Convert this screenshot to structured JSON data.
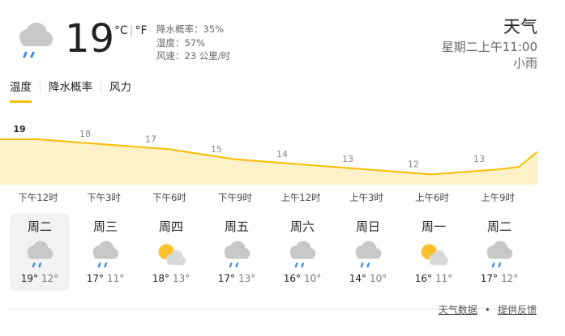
{
  "current": {
    "temp": "19",
    "unit_c": "°C",
    "unit_f": "°F",
    "precip": "降水概率：35%",
    "humidity": "湿度：57%",
    "wind": "风速：23 公里/时",
    "icon": "cloud-rain-icon"
  },
  "header": {
    "title": "天气",
    "datetime": "星期二上午11:00",
    "condition": "小雨"
  },
  "tabs": [
    {
      "label": "温度",
      "active": true
    },
    {
      "label": "降水概率",
      "active": false
    },
    {
      "label": "风力",
      "active": false
    }
  ],
  "chart_data": {
    "type": "area",
    "x": [
      "下午12时",
      "下午3时",
      "下午6时",
      "下午9时",
      "上午12时",
      "上午3时",
      "上午6时",
      "上午9时"
    ],
    "values": [
      19,
      18,
      17,
      15,
      14,
      13,
      12,
      13
    ],
    "color": "#fbbc04",
    "fill": "#fdf1c7"
  },
  "days": [
    {
      "name": "周二",
      "icon": "cloud-rain-icon",
      "hi": "19°",
      "lo": "12°",
      "selected": true
    },
    {
      "name": "周三",
      "icon": "cloud-rain-icon",
      "hi": "17°",
      "lo": "11°",
      "selected": false
    },
    {
      "name": "周四",
      "icon": "partly-sunny-icon",
      "hi": "18°",
      "lo": "13°",
      "selected": false
    },
    {
      "name": "周五",
      "icon": "cloud-rain-icon",
      "hi": "17°",
      "lo": "13°",
      "selected": false
    },
    {
      "name": "周六",
      "icon": "cloud-rain-icon",
      "hi": "16°",
      "lo": "10°",
      "selected": false
    },
    {
      "name": "周日",
      "icon": "cloud-rain-icon",
      "hi": "14°",
      "lo": "10°",
      "selected": false
    },
    {
      "name": "周一",
      "icon": "partly-sunny-icon",
      "hi": "16°",
      "lo": "11°",
      "selected": false
    },
    {
      "name": "周二",
      "icon": "cloud-rain-icon",
      "hi": "17°",
      "lo": "12°",
      "selected": false
    }
  ],
  "footer": {
    "data_link": "天气数据",
    "feedback_link": "提供反馈",
    "separator": "•"
  }
}
